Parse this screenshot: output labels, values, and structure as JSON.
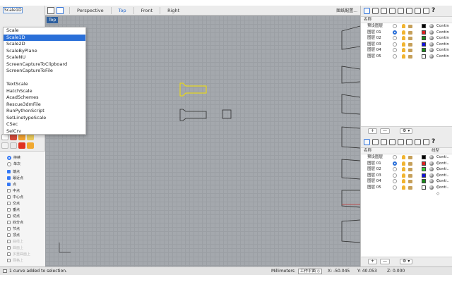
{
  "command_input": "Scale1D",
  "autocomplete": [
    {
      "label": "Scale",
      "selected": false
    },
    {
      "label": "Scale1D",
      "selected": true
    },
    {
      "label": "Scale2D",
      "selected": false
    },
    {
      "label": "ScaleByPlane",
      "selected": false
    },
    {
      "label": "ScaleNU",
      "selected": false
    },
    {
      "label": "ScreenCaptureToClipboard",
      "selected": false
    },
    {
      "label": "ScreenCaptureToFile",
      "selected": false
    },
    {
      "label": "",
      "selected": false
    },
    {
      "label": "TextScale",
      "selected": false
    },
    {
      "label": "HatchScale",
      "selected": false
    },
    {
      "label": "AcadSchemes",
      "selected": false
    },
    {
      "label": "Rescue3dmFile",
      "selected": false
    },
    {
      "label": "RunPythonScript",
      "selected": false
    },
    {
      "label": "SetLinetypeScale",
      "selected": false
    },
    {
      "label": "CSec",
      "selected": false
    },
    {
      "label": "SelCrv",
      "selected": false
    }
  ],
  "view_tabs": {
    "perspective": "Perspective",
    "top": "Top",
    "front": "Front",
    "right": "Right",
    "right_label": "图纸配置..."
  },
  "viewport_label": "Top",
  "osnap": {
    "items": [
      {
        "label": "持续",
        "kind": "radio",
        "on": true,
        "dim": false
      },
      {
        "label": "单次",
        "kind": "radio",
        "on": false,
        "dim": false
      },
      {
        "label": "端点",
        "kind": "check",
        "on": true,
        "dim": false
      },
      {
        "label": "最近点",
        "kind": "check",
        "on": true,
        "dim": false
      },
      {
        "label": "点",
        "kind": "check",
        "on": true,
        "dim": false
      },
      {
        "label": "中点",
        "kind": "check",
        "on": false,
        "dim": false
      },
      {
        "label": "中心点",
        "kind": "check",
        "on": false,
        "dim": false
      },
      {
        "label": "交点",
        "kind": "check",
        "on": false,
        "dim": false
      },
      {
        "label": "垂点",
        "kind": "check",
        "on": false,
        "dim": false
      },
      {
        "label": "切点",
        "kind": "check",
        "on": false,
        "dim": false
      },
      {
        "label": "四分点",
        "kind": "check",
        "on": false,
        "dim": false
      },
      {
        "label": "节点",
        "kind": "check",
        "on": false,
        "dim": false
      },
      {
        "label": "顶点",
        "kind": "check",
        "on": false,
        "dim": false
      },
      {
        "label": "曲线上",
        "kind": "check",
        "on": false,
        "dim": true
      },
      {
        "label": "曲面上",
        "kind": "check",
        "on": false,
        "dim": true
      },
      {
        "label": "多重曲面上",
        "kind": "check",
        "on": false,
        "dim": true
      },
      {
        "label": "网格上",
        "kind": "check",
        "on": false,
        "dim": true
      }
    ]
  },
  "layers_top": {
    "header_name": "名称",
    "header_linetype": "",
    "rows": [
      {
        "name": "预设图层",
        "current": false,
        "color": "#000000",
        "linetype": "Contin"
      },
      {
        "name": "图层 01",
        "current": true,
        "color": "#e02020",
        "linetype": "Contin"
      },
      {
        "name": "图层 02",
        "current": false,
        "color": "#1a8a1a",
        "linetype": "Contin"
      },
      {
        "name": "图层 03",
        "current": false,
        "color": "#1010e0",
        "linetype": "Contin"
      },
      {
        "name": "图层 04",
        "current": false,
        "color": "#1a8a1a",
        "linetype": "Contin"
      },
      {
        "name": "图层 05",
        "current": false,
        "color": "#ffffff",
        "linetype": "Contin"
      }
    ]
  },
  "layers_bottom": {
    "header_name": "名称",
    "header_linetype": "线型",
    "rows": [
      {
        "name": "预设图层",
        "current": false,
        "color": "#000000",
        "linetype": "Conti.. ◇"
      },
      {
        "name": "图层 01",
        "current": true,
        "color": "#e02020",
        "linetype": "Conti.. ◇"
      },
      {
        "name": "图层 02",
        "current": false,
        "color": "#33cc33",
        "linetype": "Conti.. ◇"
      },
      {
        "name": "图层 03",
        "current": false,
        "color": "#1010e0",
        "linetype": "Conti.. ◇"
      },
      {
        "name": "图层 04",
        "current": false,
        "color": "#1a8a1a",
        "linetype": "Conti.. ◇"
      },
      {
        "name": "图层 05",
        "current": false,
        "color": "#ffffff",
        "linetype": "Conti.. ◇"
      }
    ]
  },
  "panel_footer": {
    "add": "+",
    "remove": "—",
    "gear": "⚙ ▾"
  },
  "status": {
    "message": "1 curve added to selection.",
    "units": "Millimeters",
    "cplane": "工作平面 ◇",
    "x": "X: -50.045",
    "y": "Y: 40.053",
    "z": "Z: 0.000"
  },
  "colors": {
    "accent": "#2a6fd8",
    "selection": "#f5e000"
  }
}
